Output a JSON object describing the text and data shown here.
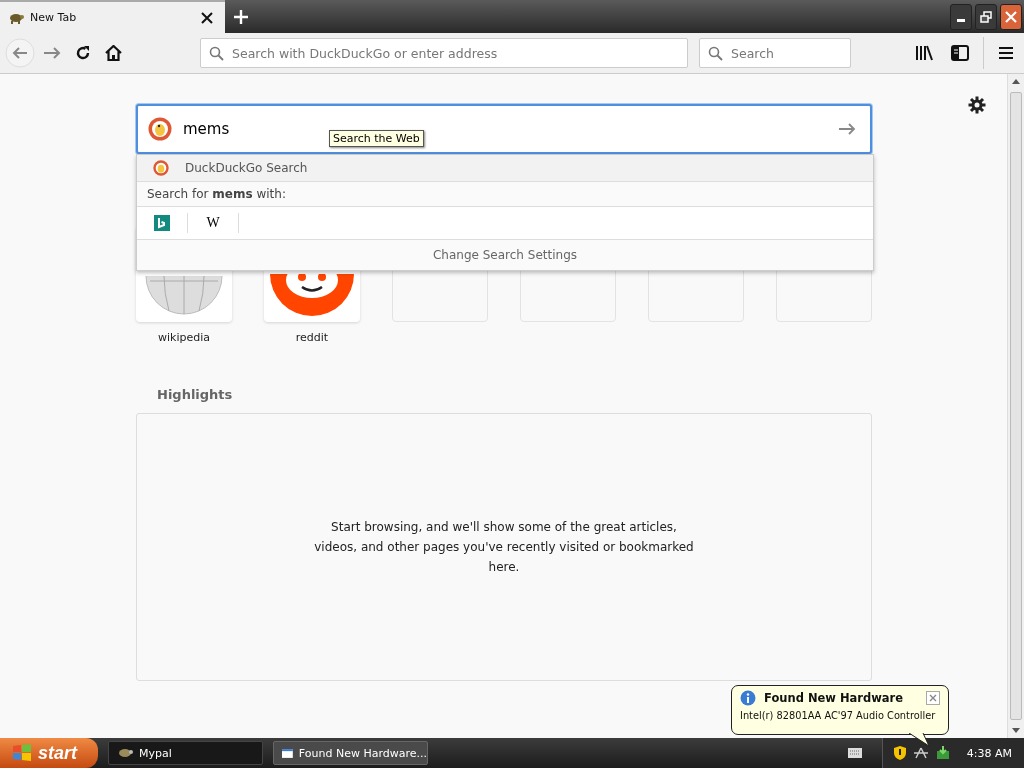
{
  "tab": {
    "title": "New Tab",
    "selected": true
  },
  "toolbar": {
    "address_placeholder": "Search with DuckDuckGo or enter address",
    "search_placeholder": "Search"
  },
  "search": {
    "value": "mems",
    "tooltip": "Search the Web"
  },
  "suggestions": {
    "engine": "DuckDuckGo Search",
    "search_for": "Search for **mems** with:",
    "engines": [
      {
        "kind": "bing"
      },
      {
        "kind": "wikipedia",
        "label": "W"
      }
    ],
    "settings_link": "Change Search Settings"
  },
  "top_sites": [
    {
      "kind": "wikipedia",
      "label": "wikipedia"
    },
    {
      "kind": "reddit",
      "label": "reddit"
    },
    {
      "kind": "empty"
    },
    {
      "kind": "empty"
    },
    {
      "kind": "empty"
    },
    {
      "kind": "empty"
    }
  ],
  "highlights": {
    "title": "Highlights",
    "message": "Start browsing, and we'll show some of the great articles, videos, and other pages you've recently visited or bookmarked here."
  },
  "taskbar": {
    "start": "start",
    "tasks": [
      {
        "kind": "browser",
        "label": "Mypal",
        "selected": true
      },
      {
        "kind": "window",
        "label": "Found New Hardware...",
        "selected": false
      }
    ],
    "clock": "4:38 AM"
  },
  "balloon": {
    "title": "Found New Hardware",
    "text": "Intel(r) 82801AA AC'97 Audio Controller"
  }
}
